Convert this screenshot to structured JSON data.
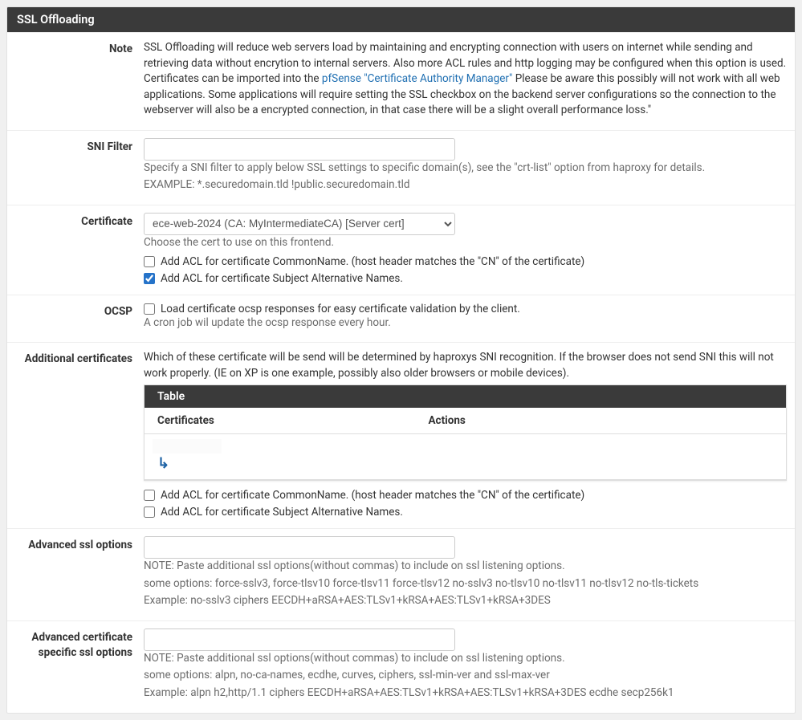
{
  "header": {
    "title": "SSL Offloading"
  },
  "note": {
    "label": "Note",
    "text_a": "SSL Offloading will reduce web servers load by maintaining and encrypting connection with users on internet while sending and retrieving data without encrytion to internal servers. Also more ACL rules and http logging may be configured when this option is used. Certificates can be imported into the ",
    "link_text": "pfSense \"Certificate Authority Manager\"",
    "text_b": " Please be aware this possibly will not work with all web applications. Some applications will require setting the SSL checkbox on the backend server configurations so the connection to the webserver will also be a encrypted connection, in that case there will be a slight overall performance loss.\""
  },
  "sni": {
    "label": "SNI Filter",
    "value": "",
    "help1": "Specify a SNI filter to apply below SSL settings to specific domain(s), see the \"crt-list\" option from haproxy for details.",
    "help2": "EXAMPLE: *.securedomain.tld !public.securedomain.tld"
  },
  "cert": {
    "label": "Certificate",
    "selected": "ece-web-2024 (CA: MyIntermediateCA) [Server cert]",
    "help": "Choose the cert to use on this frontend.",
    "acl_cn_text": "Add ACL for certificate CommonName. (host header matches the \"CN\" of the certificate)",
    "acl_cn_checked": false,
    "acl_san_text": "Add ACL for certificate Subject Alternative Names.",
    "acl_san_checked": true
  },
  "ocsp": {
    "label": "OCSP",
    "chk_text": "Load certificate ocsp responses for easy certificate validation by the client.",
    "chk_checked": false,
    "help": "A cron job wil update the ocsp response every hour."
  },
  "addl": {
    "label": "Additional certificates",
    "intro": "Which of these certificate will be send will be determined by haproxys SNI recognition. If the browser does not send SNI this will not work properly. (IE on XP is one example, possibly also older browsers or mobile devices).",
    "table_title": "Table",
    "col_certificates": "Certificates",
    "col_actions": "Actions",
    "acl_cn_text": "Add ACL for certificate CommonName. (host header matches the \"CN\" of the certificate)",
    "acl_san_text": "Add ACL for certificate Subject Alternative Names."
  },
  "adv_ssl": {
    "label": "Advanced ssl options",
    "value": "",
    "help1": "NOTE: Paste additional ssl options(without commas) to include on ssl listening options.",
    "help2": "some options: force-sslv3, force-tlsv10 force-tlsv11 force-tlsv12 no-sslv3 no-tlsv10 no-tlsv11 no-tlsv12 no-tls-tickets",
    "help3": "Example: no-sslv3 ciphers EECDH+aRSA+AES:TLSv1+kRSA+AES:TLSv1+kRSA+3DES"
  },
  "adv_cert_ssl": {
    "label": "Advanced certificate specific ssl options",
    "value": "",
    "help1": "NOTE: Paste additional ssl options(without commas) to include on ssl listening options.",
    "help2": "some options: alpn, no-ca-names, ecdhe, curves, ciphers, ssl-min-ver and ssl-max-ver",
    "help3": "Example: alpn h2,http/1.1 ciphers EECDH+aRSA+AES:TLSv1+kRSA+AES:TLSv1+kRSA+3DES ecdhe secp256k1"
  }
}
